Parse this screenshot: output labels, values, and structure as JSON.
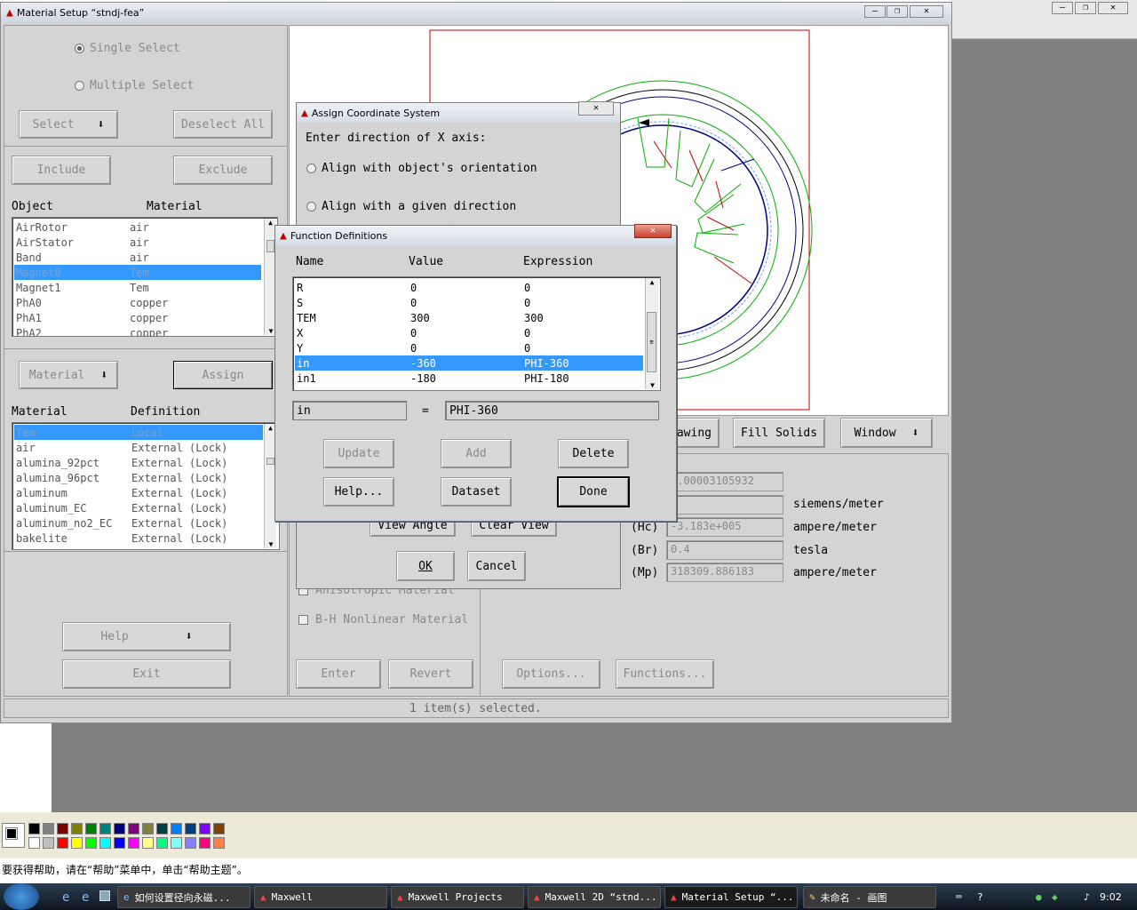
{
  "paint_bg": {
    "right_gray_titlebar": true,
    "status_text": "要获得帮助，请在“帮助”菜单中，单击“帮助主题”。",
    "palette_colors": [
      "#000000",
      "#808080",
      "#800000",
      "#808000",
      "#008000",
      "#008080",
      "#000080",
      "#800080",
      "#808040",
      "#004040",
      "#0080ff",
      "#004080",
      "#8000ff",
      "#804000",
      "#ffffff",
      "#c0c0c0",
      "#ff0000",
      "#ffff00",
      "#00ff00",
      "#00ffff",
      "#0000ff",
      "#ff00ff",
      "#ffff80",
      "#00ff80",
      "#80ffff",
      "#8080ff",
      "#ff0080",
      "#ff8040"
    ]
  },
  "main_window": {
    "title": "Material Setup “stndj-fea”",
    "single_select": "Single Select",
    "multiple_select": "Multiple Select",
    "select_btn": "Select",
    "deselect_all_btn": "Deselect All",
    "include_btn": "Include",
    "exclude_btn": "Exclude",
    "object_header": "Object",
    "material_header": "Material",
    "objects": [
      {
        "name": "AirRotor",
        "material": "air"
      },
      {
        "name": "AirStator",
        "material": "air"
      },
      {
        "name": "Band",
        "material": "air"
      },
      {
        "name": "Magnet0",
        "material": "Tem",
        "selected": true
      },
      {
        "name": "Magnet1",
        "material": "Tem"
      },
      {
        "name": "PhA0",
        "material": "copper"
      },
      {
        "name": "PhA1",
        "material": "copper"
      },
      {
        "name": "PhA2",
        "material": "copper"
      }
    ],
    "material_btn": "Material",
    "assign_btn": "Assign",
    "mat_list_header": "Material",
    "def_header": "Definition",
    "materials": [
      {
        "name": "Tem",
        "def": "Local",
        "selected": true
      },
      {
        "name": "air",
        "def": "External (Lock)"
      },
      {
        "name": "alumina_92pct",
        "def": "External (Lock)"
      },
      {
        "name": "alumina_96pct",
        "def": "External (Lock)"
      },
      {
        "name": "aluminum",
        "def": "External (Lock)"
      },
      {
        "name": "aluminum_EC",
        "def": "External (Lock)"
      },
      {
        "name": "aluminum_no2_EC",
        "def": "External (Lock)"
      },
      {
        "name": "bakelite",
        "def": "External (Lock)"
      }
    ],
    "help_btn": "Help",
    "exit_btn": "Exit",
    "drawing_btn": "awing",
    "fill_solids_btn": "Fill Solids",
    "window_btn": "Window",
    "prop_values": [
      "1.00003105932",
      "",
      "-3.183e+005",
      "0.4",
      "318309.886183"
    ],
    "prop_units": [
      "",
      "siemens/meter",
      "ampere/meter",
      "tesla",
      "ampere/meter"
    ],
    "prop_labels": [
      "",
      "",
      "(Hc)",
      "(Br)",
      "(Mp)"
    ],
    "anisotropic": "Anisotropic Material",
    "bh_nonlinear": "B-H Nonlinear Material",
    "enter_btn": "Enter",
    "revert_btn": "Revert",
    "options_btn": "Options...",
    "functions_btn": "Functions...",
    "status": "1 item(s) selected."
  },
  "assign_cs": {
    "title": "Assign Coordinate System",
    "prompt": "Enter direction of X axis:",
    "opt1": "Align with object's orientation",
    "opt2": "Align with a given direction",
    "view_angle": "View Angle",
    "clear_view": "Clear View",
    "ok": "OK",
    "cancel": "Cancel"
  },
  "func_defs": {
    "title": "Function Definitions",
    "col_name": "Name",
    "col_value": "Value",
    "col_expr": "Expression",
    "rows": [
      {
        "name": "R",
        "value": "0",
        "expr": "0"
      },
      {
        "name": "S",
        "value": "0",
        "expr": "0"
      },
      {
        "name": "TEM",
        "value": "300",
        "expr": "300"
      },
      {
        "name": "X",
        "value": "0",
        "expr": "0"
      },
      {
        "name": "Y",
        "value": "0",
        "expr": "0"
      },
      {
        "name": "in",
        "value": "-360",
        "expr": "PHI-360",
        "selected": true
      },
      {
        "name": "in1",
        "value": "-180",
        "expr": "PHI-180"
      }
    ],
    "name_field": "in",
    "equals": "=",
    "expr_field": "PHI-360",
    "update": "Update",
    "add": "Add",
    "delete": "Delete",
    "help": "Help...",
    "dataset": "Dataset",
    "done": "Done"
  },
  "taskbar": {
    "items": [
      "如何设置径向永磁...",
      "Maxwell",
      "Maxwell Projects",
      "Maxwell 2D “stnd...",
      "Material Setup “...",
      "未命名 - 画图"
    ],
    "clock": "9:02"
  }
}
